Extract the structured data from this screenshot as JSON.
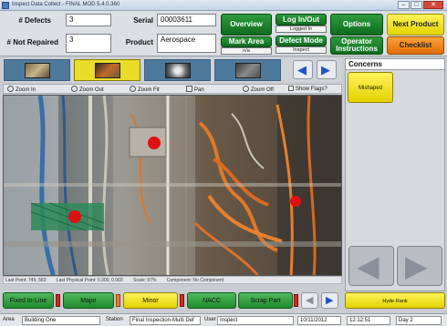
{
  "window": {
    "title": "Inspect Data Collect - FINAL MOD 5.4.0.360",
    "minimize": "–",
    "maximize": "□",
    "close": "✕"
  },
  "header": {
    "defects_label": "# Defects",
    "defects_value": "3",
    "not_repaired_label": "# Not Repaired",
    "not_repaired_value": "3",
    "serial_label": "Serial",
    "serial_value": "00003611",
    "product_label": "Product",
    "product_value": "Aerospace",
    "overview": "Overview",
    "mark_area": "Mark Area",
    "mark_area_sub": "n/a",
    "login": "Log In/Out",
    "login_sub": "Logged In",
    "defect_mode": "Defect Mode",
    "defect_mode_sub": "Inspect",
    "options": "Options",
    "operator_instructions": "Operator Instructions",
    "next_product": "Next Product",
    "checklist": "Checklist"
  },
  "zoombar": {
    "zoom_in": "Zoom In",
    "zoom_out": "Zoom Out",
    "zoom_fit": "Zoom Fit",
    "pan": "Pan",
    "zoom_off": "Zoom Off",
    "show_flags": "Show Flags?"
  },
  "photo_status": {
    "last_point": "Last Point:  749,  583",
    "last_physical_point": "Last Physical Point: 0.300, 0.060",
    "scale": "Scale: 97%",
    "component": "Component: No Component"
  },
  "concerns": {
    "title": "Concerns",
    "items": [
      "Mishaped"
    ]
  },
  "actions": {
    "fixed_inline": "Fixed In-Line",
    "major": "Major",
    "minor": "Minor",
    "nacc": "NACC",
    "scrap_part": "Scrap Part",
    "right_button": "Hyde Rank"
  },
  "statusbar": {
    "area_label": "Area",
    "area_value": "Building One",
    "station_label": "Station",
    "station_value": "Final Inspection-Multi Def",
    "user_label": "User",
    "user_value": "Inspect",
    "date_value": "10/11/2012",
    "time_value": "12:12:51",
    "day_value": "Day 2"
  },
  "colors": {
    "green": "#1f8a2d",
    "yellow": "#e2d200",
    "orange": "#e06e00",
    "defect_marker": "#e01010",
    "nav_blue": "#1f55c4"
  }
}
